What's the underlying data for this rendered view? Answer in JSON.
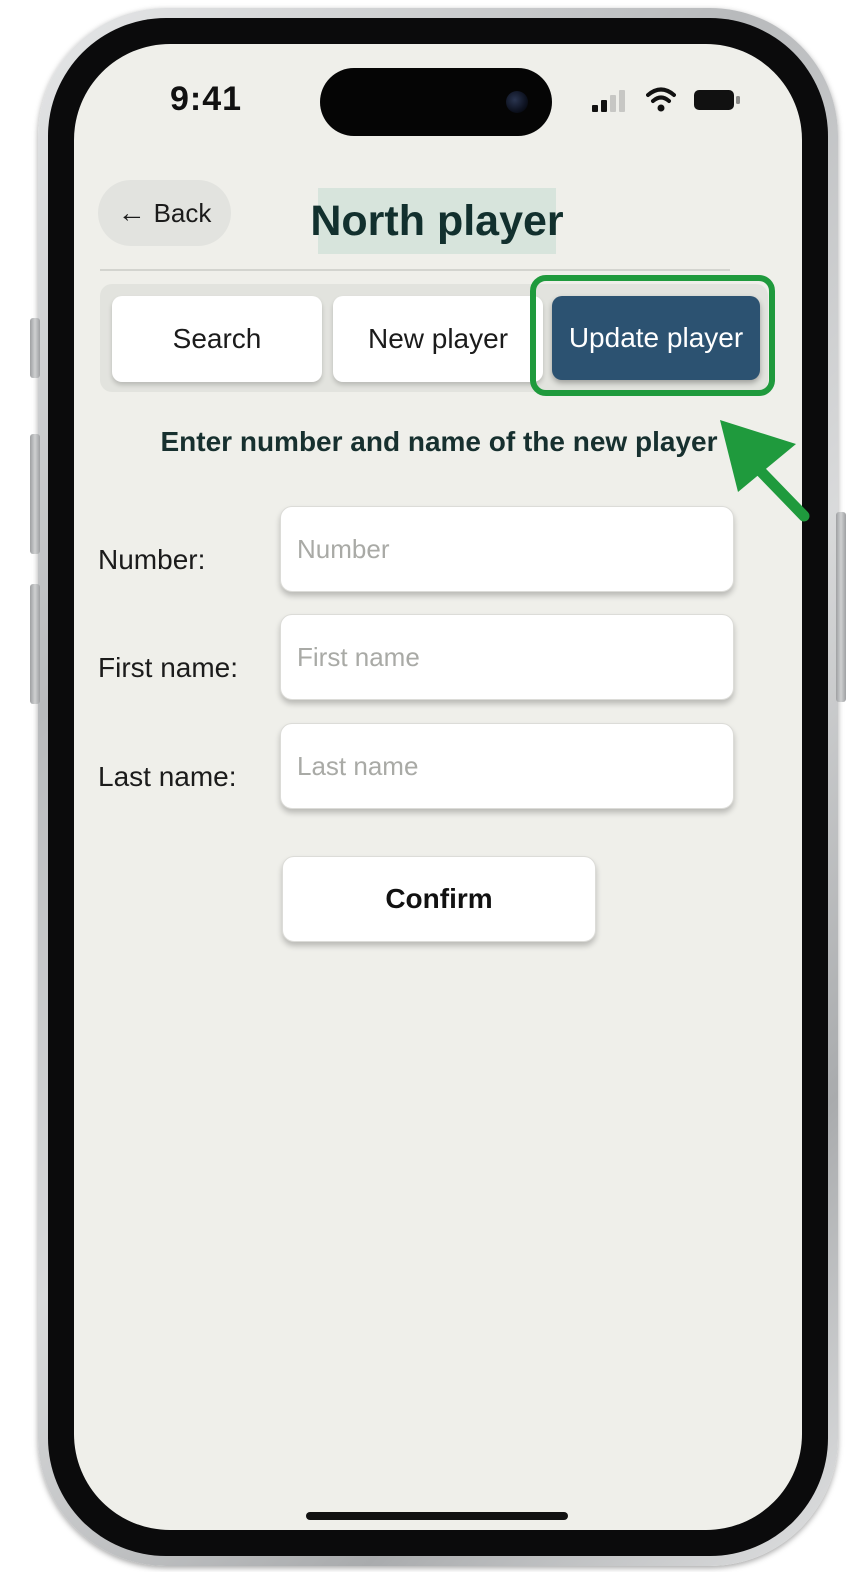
{
  "status_bar": {
    "time": "9:41",
    "icons": [
      "signal-icon",
      "wifi-icon",
      "battery-icon"
    ]
  },
  "header": {
    "back_label": "Back",
    "back_icon": "arrow-left-icon",
    "title": "North player"
  },
  "tabs": [
    {
      "label": "Search",
      "selected": false
    },
    {
      "label": "New player",
      "selected": false
    },
    {
      "label": "Update player",
      "selected": true
    }
  ],
  "form": {
    "instruction": "Enter number and name of the new player",
    "fields": [
      {
        "label": "Number:",
        "placeholder": "Number",
        "value": ""
      },
      {
        "label": "First name:",
        "placeholder": "First name",
        "value": ""
      },
      {
        "label": "Last name:",
        "placeholder": "Last name",
        "value": ""
      }
    ],
    "confirm_label": "Confirm"
  },
  "annotation": {
    "highlight_color": "#1f9a3d",
    "target": "Update player"
  },
  "colors": {
    "accent": "#2c5271",
    "screen_background": "#efefea",
    "title_highlight": "#d7e4dc"
  }
}
